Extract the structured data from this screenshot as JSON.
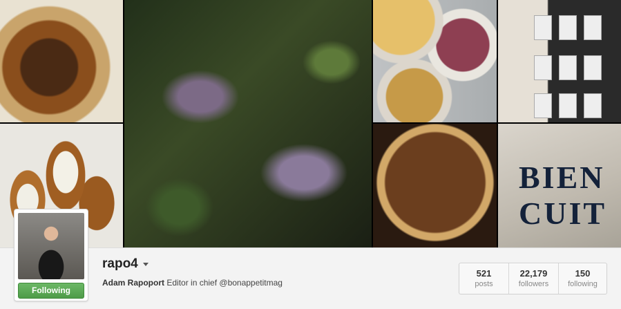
{
  "profile": {
    "username": "rapo4",
    "full_name": "Adam Rapoport",
    "bio": "Editor in chief @bonappetitmag",
    "follow_button_label": "Following",
    "follow_button_color": "#5aa852"
  },
  "stats": [
    {
      "value": "521",
      "label": "posts"
    },
    {
      "value": "22,179",
      "label": "followers"
    },
    {
      "value": "150",
      "label": "following"
    }
  ],
  "cover_photos": {
    "bag_text": "BIEN CUIT"
  },
  "icons": {
    "menu": "chevron-down-icon"
  }
}
